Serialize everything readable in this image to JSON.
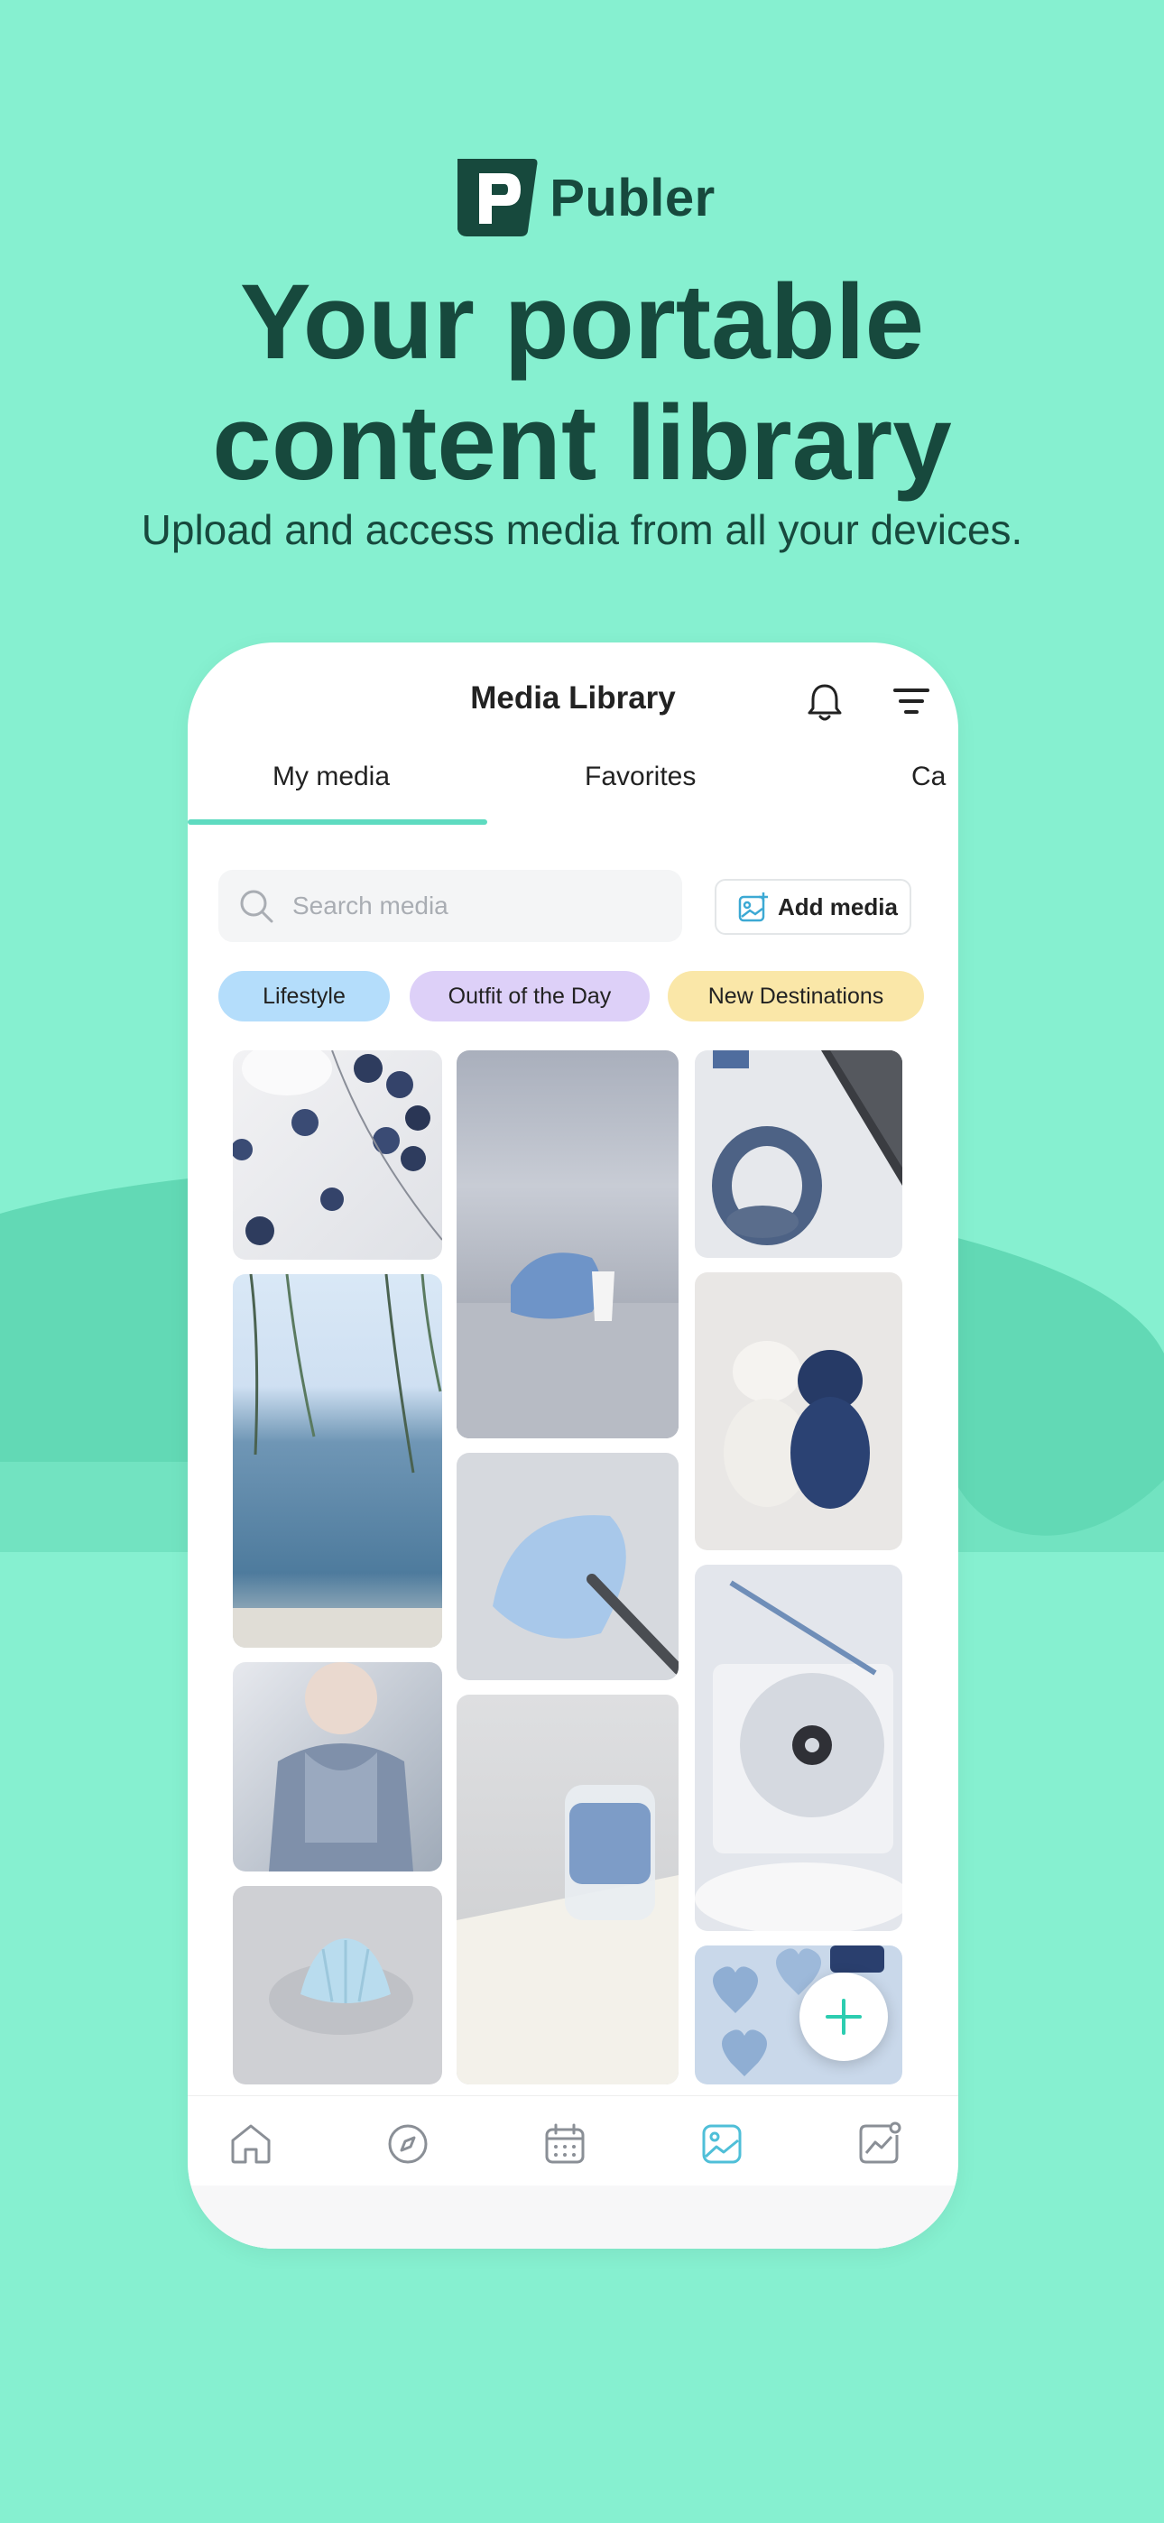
{
  "brand": {
    "name": "Publer"
  },
  "hero": {
    "headline_line1": "Your portable",
    "headline_line2": "content library",
    "subtitle": "Upload and access media from all your devices."
  },
  "app": {
    "title": "Media Library",
    "tabs": [
      {
        "label": "My media",
        "active": true
      },
      {
        "label": "Favorites",
        "active": false
      },
      {
        "label": "Ca",
        "active": false
      }
    ],
    "search": {
      "placeholder": "Search media"
    },
    "add_media_label": "Add media",
    "chips": [
      {
        "label": "Lifestyle",
        "color": "#B4DDFB"
      },
      {
        "label": "Outfit of the Day",
        "color": "#DDD0F8"
      },
      {
        "label": "New Destinations",
        "color": "#FAE7A8"
      }
    ],
    "nav": [
      "home-icon",
      "compass-icon",
      "calendar-icon",
      "media-icon",
      "analytics-icon"
    ],
    "active_nav": "media-icon"
  },
  "colors": {
    "background": "#86F0D0",
    "wave": "#62D9B4",
    "brand_dark": "#17493D",
    "accent": "#5EDBC0",
    "nav_active": "#4FBFD8"
  }
}
